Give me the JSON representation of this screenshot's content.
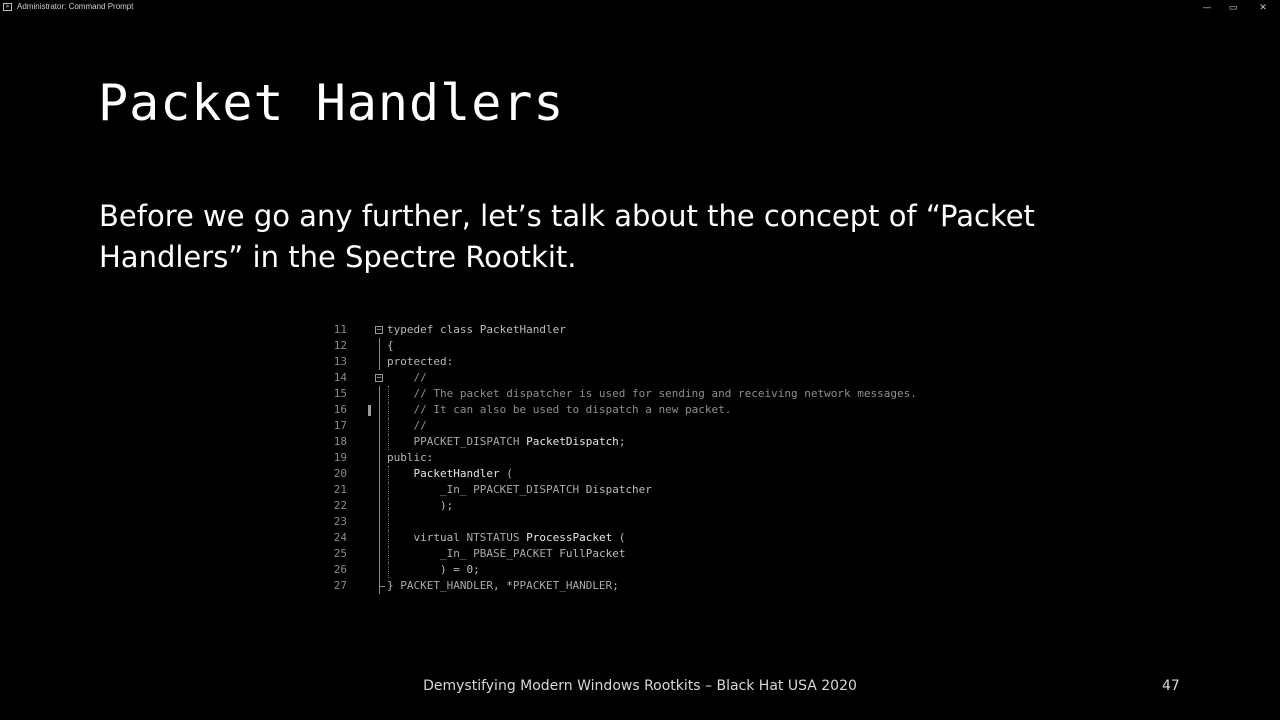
{
  "window": {
    "title": "Administrator: Command Prompt",
    "icon": "cmd-icon",
    "controls": {
      "minimize": "—",
      "maximize": "▭",
      "close": "✕"
    }
  },
  "slide": {
    "title": "Packet Handlers",
    "body": "Before we go any further, let’s talk about the concept of “Packet Handlers” in the Spectre Rootkit.",
    "footer": "Demystifying Modern Windows Rootkits – Black Hat USA 2020",
    "page_number": "47"
  },
  "code": {
    "lines": [
      {
        "n": "11",
        "segments": [
          [
            "kw",
            "typedef"
          ],
          [
            "pl",
            " "
          ],
          [
            "kw",
            "class"
          ],
          [
            "pl",
            " PacketHandler"
          ]
        ]
      },
      {
        "n": "12",
        "segments": [
          [
            "pl",
            "{"
          ]
        ]
      },
      {
        "n": "13",
        "segments": [
          [
            "kw",
            "protected"
          ],
          [
            "pl",
            ":"
          ]
        ]
      },
      {
        "n": "14",
        "segments": [
          [
            "pl",
            "    "
          ],
          [
            "cm",
            "//"
          ]
        ]
      },
      {
        "n": "15",
        "segments": [
          [
            "pl",
            "    "
          ],
          [
            "cm",
            "// The packet dispatcher is used for sending and receiving network messages."
          ]
        ]
      },
      {
        "n": "16",
        "segments": [
          [
            "pl",
            "    "
          ],
          [
            "cm",
            "// It can also be used to dispatch a new packet."
          ]
        ]
      },
      {
        "n": "17",
        "segments": [
          [
            "pl",
            "    "
          ],
          [
            "cm",
            "//"
          ]
        ]
      },
      {
        "n": "18",
        "segments": [
          [
            "pl",
            "    "
          ],
          [
            "ty",
            "PPACKET_DISPATCH"
          ],
          [
            "pl",
            " "
          ],
          [
            "hi",
            "PacketDispatch"
          ],
          [
            "pl",
            ";"
          ]
        ]
      },
      {
        "n": "19",
        "segments": [
          [
            "kw",
            "public"
          ],
          [
            "pl",
            ":"
          ]
        ]
      },
      {
        "n": "20",
        "segments": [
          [
            "pl",
            "    "
          ],
          [
            "hi",
            "PacketHandler"
          ],
          [
            "pl",
            " ("
          ]
        ]
      },
      {
        "n": "21",
        "segments": [
          [
            "pl",
            "        "
          ],
          [
            "ty",
            "_In_"
          ],
          [
            "pl",
            " "
          ],
          [
            "ty",
            "PPACKET_DISPATCH"
          ],
          [
            "pl",
            " Dispatcher"
          ]
        ]
      },
      {
        "n": "22",
        "segments": [
          [
            "pl",
            "        );"
          ]
        ]
      },
      {
        "n": "23",
        "segments": [
          [
            "pl",
            ""
          ]
        ]
      },
      {
        "n": "24",
        "segments": [
          [
            "pl",
            "    "
          ],
          [
            "kw",
            "virtual"
          ],
          [
            "pl",
            " "
          ],
          [
            "ty",
            "NTSTATUS"
          ],
          [
            "pl",
            " "
          ],
          [
            "hi",
            "ProcessPacket"
          ],
          [
            "pl",
            " ("
          ]
        ]
      },
      {
        "n": "25",
        "segments": [
          [
            "pl",
            "        "
          ],
          [
            "ty",
            "_In_"
          ],
          [
            "pl",
            " "
          ],
          [
            "ty",
            "PBASE_PACKET"
          ],
          [
            "pl",
            " FullPacket"
          ]
        ]
      },
      {
        "n": "26",
        "segments": [
          [
            "pl",
            "        ) = 0;"
          ]
        ]
      },
      {
        "n": "27",
        "segments": [
          [
            "pl",
            "} "
          ],
          [
            "ty",
            "PACKET_HANDLER"
          ],
          [
            "pl",
            ", *"
          ],
          [
            "ty",
            "PPACKET_HANDLER"
          ],
          [
            "pl",
            ";"
          ]
        ]
      }
    ],
    "fold_lines": [
      "11",
      "14"
    ],
    "change_marker_line": "16",
    "fold_glyph": "−"
  }
}
